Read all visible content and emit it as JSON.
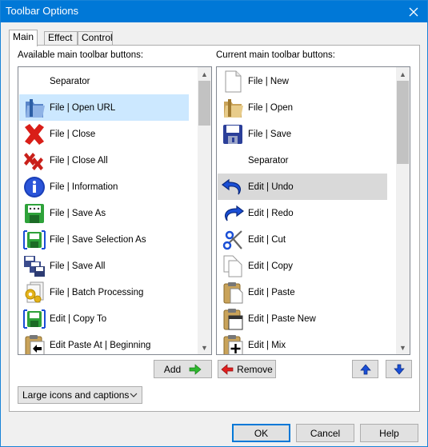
{
  "window": {
    "title": "Toolbar Options"
  },
  "tabs": [
    {
      "label": "Main"
    },
    {
      "label": "Effect"
    },
    {
      "label": "Control"
    }
  ],
  "available": {
    "label": "Available main toolbar buttons:",
    "items": [
      {
        "label": "Separator",
        "icon": "none"
      },
      {
        "label": "File | Open URL",
        "icon": "open-url-icon"
      },
      {
        "label": "File | Close",
        "icon": "close-file-icon"
      },
      {
        "label": "File | Close All",
        "icon": "close-all-icon"
      },
      {
        "label": "File | Information",
        "icon": "information-icon"
      },
      {
        "label": "File | Save As",
        "icon": "save-as-icon"
      },
      {
        "label": "File | Save Selection As",
        "icon": "save-selection-as-icon"
      },
      {
        "label": "File | Save All",
        "icon": "save-all-icon"
      },
      {
        "label": "File | Batch Processing",
        "icon": "batch-processing-icon"
      },
      {
        "label": "Edit | Copy To",
        "icon": "copy-to-icon"
      },
      {
        "label": "Edit Paste At | Beginning",
        "icon": "paste-at-beginning-icon"
      }
    ]
  },
  "current": {
    "label": "Current main toolbar buttons:",
    "items": [
      {
        "label": "File | New",
        "icon": "new-file-icon"
      },
      {
        "label": "File | Open",
        "icon": "open-folder-icon"
      },
      {
        "label": "File | Save",
        "icon": "save-icon"
      },
      {
        "label": "Separator",
        "icon": "none"
      },
      {
        "label": "Edit | Undo",
        "icon": "undo-icon"
      },
      {
        "label": "Edit | Redo",
        "icon": "redo-icon"
      },
      {
        "label": "Edit | Cut",
        "icon": "scissors-icon"
      },
      {
        "label": "Edit | Copy",
        "icon": "copy-icon"
      },
      {
        "label": "Edit | Paste",
        "icon": "paste-icon"
      },
      {
        "label": "Edit | Paste New",
        "icon": "paste-new-icon"
      },
      {
        "label": "Edit | Mix",
        "icon": "mix-icon"
      }
    ]
  },
  "buttons": {
    "add": "Add",
    "remove": "Remove",
    "ok": "OK",
    "cancel": "Cancel",
    "help": "Help"
  },
  "icon_style": {
    "selected": "Large icons and captions"
  },
  "colors": {
    "titlebar": "#0078d7",
    "selection_blue": "#cce8ff",
    "selection_gray": "#d9d9d9",
    "arrow_green": "#2eb82e",
    "arrow_red": "#e02020",
    "arrow_blue": "#1a4fd6"
  }
}
